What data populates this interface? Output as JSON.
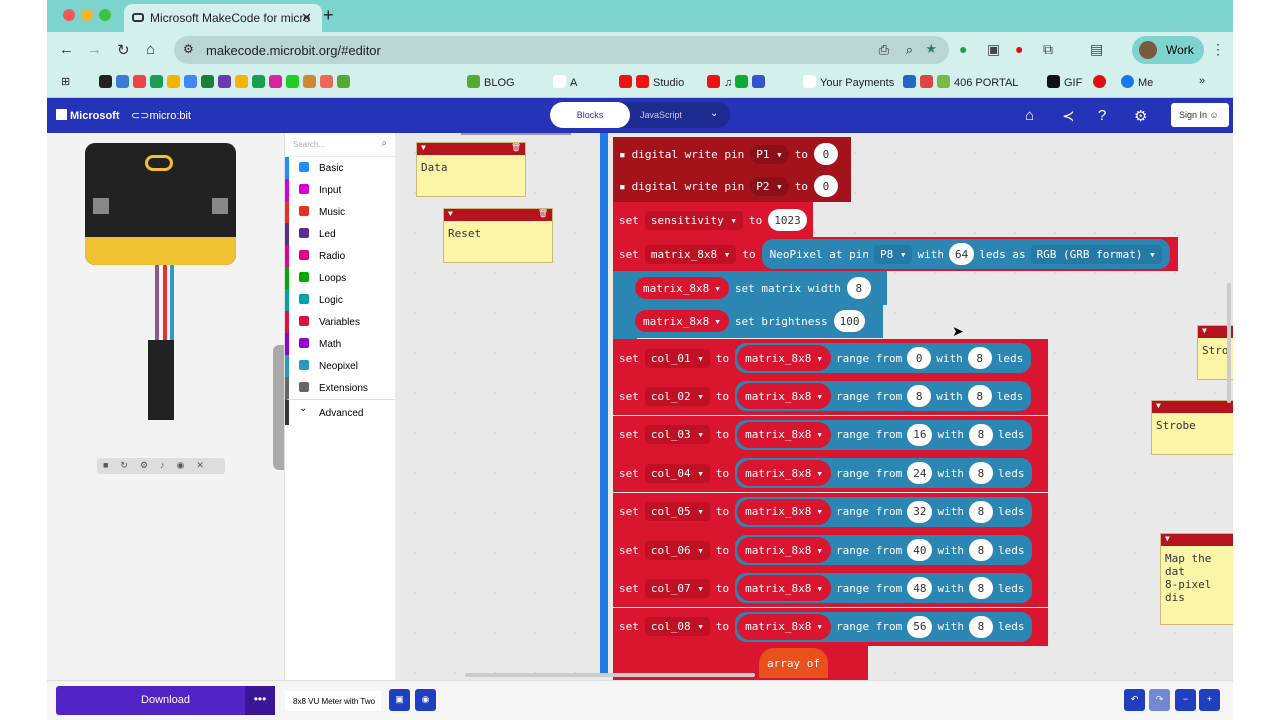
{
  "browser": {
    "tab_title": "Microsoft MakeCode for micro",
    "url": "makecode.microbit.org/#editor",
    "profile": "Work",
    "bookmarks": [
      "BLOG",
      "A",
      "Studio",
      "Your Payments",
      "406 PORTAL",
      "GIF",
      "Me"
    ]
  },
  "header": {
    "brand": "Microsoft",
    "product": "micro:bit",
    "blocks_tab": "Blocks",
    "js_tab": "JavaScript",
    "sign_in": "Sign In"
  },
  "toolbox": {
    "search_placeholder": "Search...",
    "categories": [
      {
        "label": "Basic",
        "color": "#1e90ff"
      },
      {
        "label": "Input",
        "color": "#d400d4"
      },
      {
        "label": "Music",
        "color": "#e63022"
      },
      {
        "label": "Led",
        "color": "#5c2d91"
      },
      {
        "label": "Radio",
        "color": "#e3008c"
      },
      {
        "label": "Loops",
        "color": "#00aa00"
      },
      {
        "label": "Logic",
        "color": "#00a4a6"
      },
      {
        "label": "Variables",
        "color": "#dc143c"
      },
      {
        "label": "Math",
        "color": "#9400d3"
      },
      {
        "label": "Neopixel",
        "color": "#2699bf"
      },
      {
        "label": "Extensions",
        "color": "#666666"
      },
      {
        "label": "Advanced",
        "color": "#333333"
      }
    ]
  },
  "comments": {
    "data": "Data",
    "reset": "Reset",
    "strobe1": "Stro",
    "strobe2": "Strobe",
    "map": "Map the dat",
    "map2": "8-pixel dis"
  },
  "blocks": {
    "dw1": {
      "label": "digital write pin",
      "pin": "P1",
      "to": "to",
      "value": "0"
    },
    "dw2": {
      "label": "digital write pin",
      "pin": "P2",
      "to": "to",
      "value": "0"
    },
    "set": "set",
    "to": "to",
    "sens": {
      "var": "sensitivity",
      "value": "1023"
    },
    "matrix": {
      "var": "matrix_8x8",
      "neo": "NeoPixel at pin",
      "pin": "P8",
      "with": "with",
      "count": "64",
      "leds_as": "leds as",
      "format": "RGB (GRB format)"
    },
    "width": {
      "var": "matrix_8x8",
      "label": "set matrix width",
      "value": "8"
    },
    "bright": {
      "var": "matrix_8x8",
      "label": "set brightness",
      "value": "100"
    },
    "range_from": "range from",
    "with": "with",
    "leds": "leds",
    "cols": [
      {
        "var": "col_01",
        "from": "0",
        "n": "8"
      },
      {
        "var": "col_02",
        "from": "8",
        "n": "8"
      },
      {
        "var": "col_03",
        "from": "16",
        "n": "8"
      },
      {
        "var": "col_04",
        "from": "24",
        "n": "8"
      },
      {
        "var": "col_05",
        "from": "32",
        "n": "8"
      },
      {
        "var": "col_06",
        "from": "40",
        "n": "8"
      },
      {
        "var": "col_07",
        "from": "48",
        "n": "8"
      },
      {
        "var": "col_08",
        "from": "56",
        "n": "8"
      }
    ],
    "array_of": "array of"
  },
  "bottom": {
    "download": "Download",
    "more": "•••",
    "project_name": "8x8 VU Meter with Two"
  }
}
